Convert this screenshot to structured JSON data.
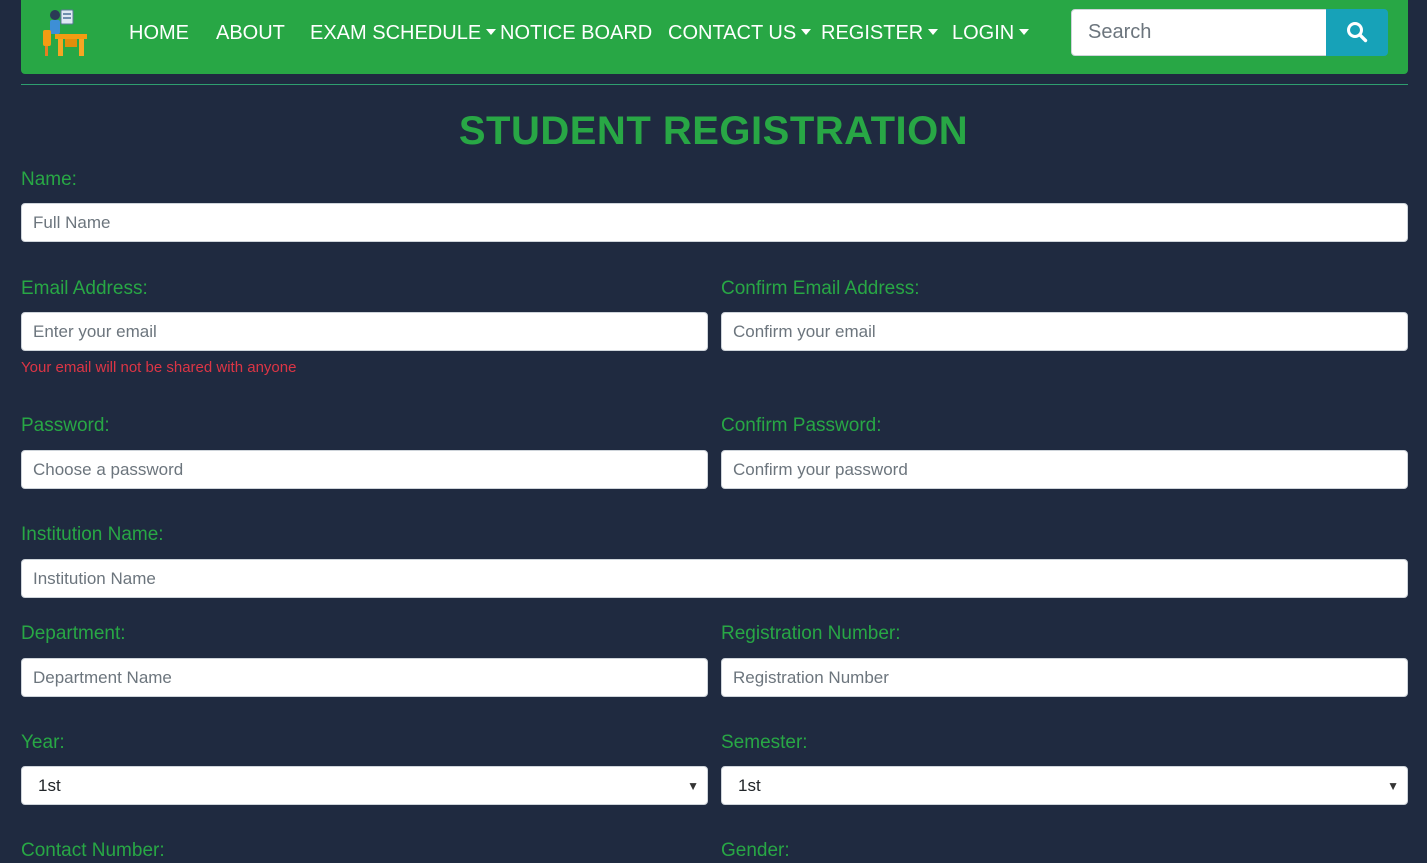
{
  "nav": {
    "logo": "desk-person-logo",
    "items": [
      {
        "label": "HOME",
        "dropdown": false
      },
      {
        "label": "ABOUT",
        "dropdown": false
      },
      {
        "label": "EXAM SCHEDULE",
        "dropdown": true
      },
      {
        "label": "NOTICE BOARD",
        "dropdown": false
      },
      {
        "label": "CONTACT US",
        "dropdown": true
      },
      {
        "label": "REGISTER",
        "dropdown": true
      },
      {
        "label": "LOGIN",
        "dropdown": true
      }
    ],
    "search": {
      "placeholder": "Search",
      "icon": "search-icon"
    }
  },
  "form": {
    "title": "STUDENT REGISTRATION",
    "name": {
      "label": "Name:",
      "placeholder": "Full Name"
    },
    "email": {
      "label": "Email Address:",
      "placeholder": "Enter your email",
      "help": "Your email will not be shared with anyone"
    },
    "confirm_email": {
      "label": "Confirm Email Address:",
      "placeholder": "Confirm your email"
    },
    "password": {
      "label": "Password:",
      "placeholder": "Choose a password"
    },
    "confirm_password": {
      "label": "Confirm Password:",
      "placeholder": "Confirm your password"
    },
    "institution": {
      "label": "Institution Name:",
      "placeholder": "Institution Name"
    },
    "department": {
      "label": "Department:",
      "placeholder": "Department Name"
    },
    "registration": {
      "label": "Registration Number:",
      "placeholder": "Registration Number"
    },
    "year": {
      "label": "Year:",
      "value": "1st"
    },
    "semester": {
      "label": "Semester:",
      "value": "1st"
    },
    "contact": {
      "label": "Contact Number:"
    },
    "gender": {
      "label": "Gender:"
    }
  },
  "colors": {
    "background": "#1f2a40",
    "navbar": "#28a745",
    "accent": "#28a745",
    "search_button": "#17a2b8",
    "help_text": "#dc3545"
  }
}
